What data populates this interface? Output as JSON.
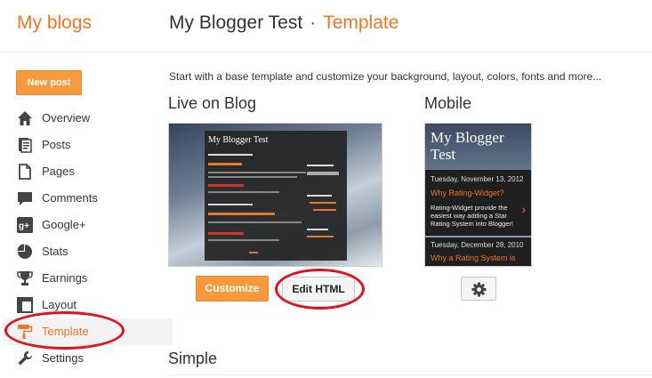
{
  "header": {
    "brand": "My blogs",
    "blog_title": "My Blogger Test",
    "separator": "·",
    "section": "Template"
  },
  "sidebar": {
    "new_post": "New post",
    "items": [
      {
        "label": "Overview",
        "icon": "home-icon"
      },
      {
        "label": "Posts",
        "icon": "posts-icon"
      },
      {
        "label": "Pages",
        "icon": "pages-icon"
      },
      {
        "label": "Comments",
        "icon": "comments-icon"
      },
      {
        "label": "Google+",
        "icon": "google-plus-icon"
      },
      {
        "label": "Stats",
        "icon": "stats-icon"
      },
      {
        "label": "Earnings",
        "icon": "trophy-icon"
      },
      {
        "label": "Layout",
        "icon": "layout-icon"
      },
      {
        "label": "Template",
        "icon": "paint-roller-icon",
        "active": true
      },
      {
        "label": "Settings",
        "icon": "wrench-icon"
      }
    ]
  },
  "main": {
    "intro": "Start with a base template and customize your background, layout, colors, fonts and more...",
    "live": {
      "title": "Live on Blog",
      "preview_title": "My Blogger Test",
      "customize": "Customize",
      "edit_html": "Edit HTML"
    },
    "mobile": {
      "title": "Mobile",
      "preview_title": "My Blogger Test",
      "post1_date": "Tuesday, November 13, 2012",
      "post1_title": "Why Rating-Widget?",
      "post1_body": "Rating-Widget provide the easiest way adding a Star Rating System into Blogger!",
      "post2_date": "Tuesday, December 28, 2010",
      "post2_title": "Why a Rating System is",
      "arrow": "›"
    },
    "simple_title": "Simple"
  },
  "colors": {
    "accent": "#e8772e",
    "button": "#f79a3e",
    "highlight_ring": "#e0121b"
  }
}
